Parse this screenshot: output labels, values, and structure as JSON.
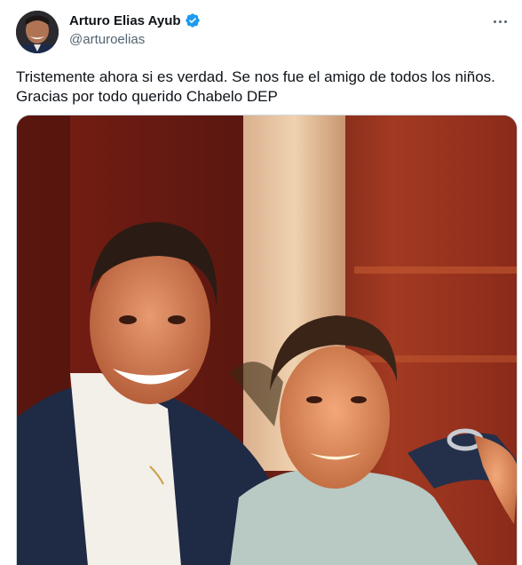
{
  "author": {
    "display_name": "Arturo Elias Ayub",
    "handle": "@arturoelias",
    "verified": true,
    "verified_color": "#1d9bf0"
  },
  "tweet": {
    "text": "Tristemente ahora si es verdad.  Se nos fue el amigo de todos los niños.\nGracias por todo querido Chabelo DEP"
  },
  "media": {
    "type": "photo",
    "content": "photo-of-two-smiling-men"
  },
  "icons": {
    "more": "more-options-icon",
    "verified": "verified-badge-icon"
  }
}
